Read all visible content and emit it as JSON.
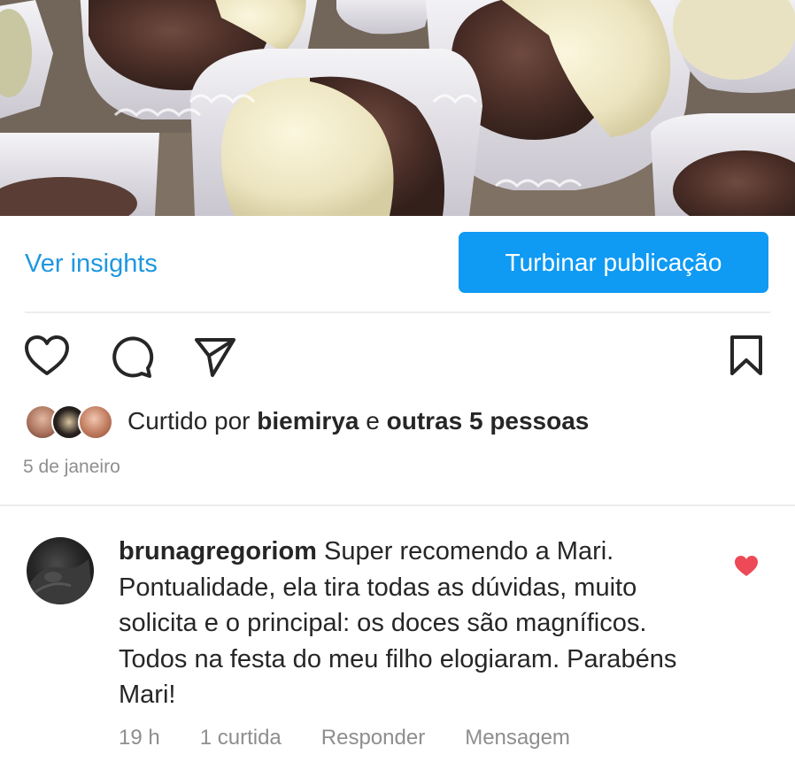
{
  "post": {
    "image_description_icon": "photo-brigadeiros"
  },
  "actions": {
    "insights_label": "Ver insights",
    "boost_label": "Turbinar publicação"
  },
  "icons": {
    "like": "heart-outline-icon",
    "comment": "comment-icon",
    "share": "send-icon",
    "save": "bookmark-icon"
  },
  "likes": {
    "prefix": "Curtido por ",
    "user": "biemirya",
    "joiner": " e ",
    "others": "outras 5 pessoas"
  },
  "post_date": "5 de janeiro",
  "comment": {
    "username": "brunagregoriom",
    "text": "Super recomendo a Mari. Pontualidade, ela tira todas as dúvidas, muito solicita e o principal: os doces são magníficos. Todos na festa do meu filho elogiaram. Parabéns Mari!",
    "time": "19 h",
    "likes": "1 curtida",
    "reply_label": "Responder",
    "message_label": "Mensagem",
    "liked": true
  },
  "colors": {
    "link_blue": "#1f97e0",
    "button_blue": "#0f9af4",
    "heart_red": "#ed4956",
    "muted_text": "#8e8e8e"
  }
}
